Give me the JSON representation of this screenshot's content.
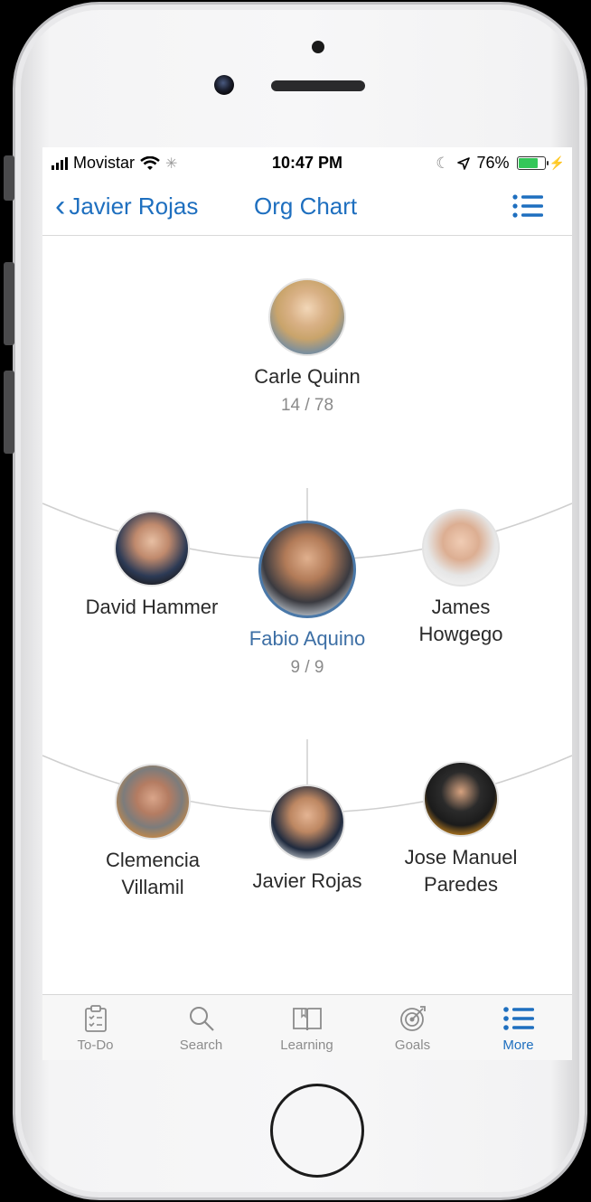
{
  "status_bar": {
    "carrier": "Movistar",
    "time": "10:47 PM",
    "battery": "76%"
  },
  "nav": {
    "back_label": "Javier Rojas",
    "title": "Org Chart"
  },
  "org_chart": {
    "manager": {
      "name": "Carle Quinn",
      "count": "14 / 78"
    },
    "peers_row": [
      {
        "name": "David Hammer"
      },
      {
        "name": "Fabio Aquino",
        "count": "9 / 9"
      },
      {
        "name": "James Howgego"
      }
    ],
    "reports_row": [
      {
        "name": "Clemencia Villamil"
      },
      {
        "name": "Javier Rojas"
      },
      {
        "name": "Jose Manuel Paredes"
      }
    ]
  },
  "tab_bar": {
    "items": [
      {
        "label": "To-Do",
        "icon": "clipboard-check-icon"
      },
      {
        "label": "Search",
        "icon": "search-icon"
      },
      {
        "label": "Learning",
        "icon": "book-icon"
      },
      {
        "label": "Goals",
        "icon": "target-icon"
      },
      {
        "label": "More",
        "icon": "list-icon",
        "active": true
      }
    ]
  },
  "colors": {
    "accent": "#1e6fbf",
    "focus_name": "#3d6fa5",
    "battery": "#34c759"
  }
}
